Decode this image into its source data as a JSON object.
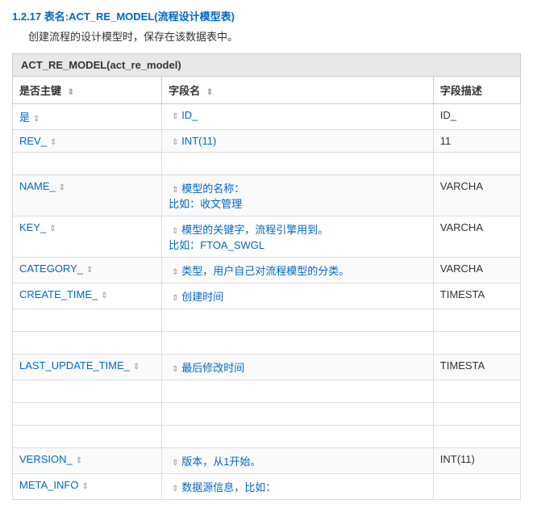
{
  "page": {
    "title": "1.2.17 表名:ACT_RE_MODEL(流程设计模型表)",
    "subtitle": "创建流程的设计模型时，保存在该数据表中。",
    "table_heading": "ACT_RE_MODEL(act_re_model)"
  },
  "table": {
    "headers": {
      "pk": "是否主键",
      "field": "字段名",
      "desc": "字段描述"
    },
    "rows": [
      {
        "pk": "是",
        "field": "ID_",
        "desc": "ID_",
        "is_primary": true,
        "empty_before": false
      },
      {
        "pk": "REV_",
        "field": "INT(11)",
        "desc": "11",
        "is_primary": false,
        "empty_before": false
      },
      {
        "pk": "",
        "field": "",
        "desc": "",
        "is_empty": true
      },
      {
        "pk": "NAME_",
        "field": "模型的名称：\n比如：收文管理",
        "desc": "VARCHA",
        "is_primary": false,
        "empty_before": false
      },
      {
        "pk": "KEY_",
        "field": "模型的关键字，流程引擎用到。\n比如：FTOA_SWGL",
        "desc": "VARCHA",
        "is_primary": false
      },
      {
        "pk": "CATEGORY_",
        "field": "类型，用户自己对流程模型的分类。",
        "desc": "VARCHA",
        "is_primary": false
      },
      {
        "pk": "CREATE_TIME_",
        "field": "创建时间",
        "desc": "TIMESTA",
        "is_primary": false
      },
      {
        "pk": "",
        "field": "",
        "desc": "",
        "is_empty": true
      },
      {
        "pk": "",
        "field": "",
        "desc": "",
        "is_empty": true
      },
      {
        "pk": "LAST_UPDATE_TIME_",
        "field": "最后修改时间",
        "desc": "TIMESTA",
        "is_primary": false
      },
      {
        "pk": "",
        "field": "",
        "desc": "",
        "is_empty": true
      },
      {
        "pk": "",
        "field": "",
        "desc": "",
        "is_empty": true
      },
      {
        "pk": "",
        "field": "",
        "desc": "",
        "is_empty": true
      },
      {
        "pk": "VERSION_",
        "field": "版本，从1开始。",
        "desc": "INT(11)",
        "is_primary": false
      },
      {
        "pk": "META_INFO",
        "field": "数据源信息，比如：",
        "desc": "",
        "is_primary": false
      }
    ]
  }
}
